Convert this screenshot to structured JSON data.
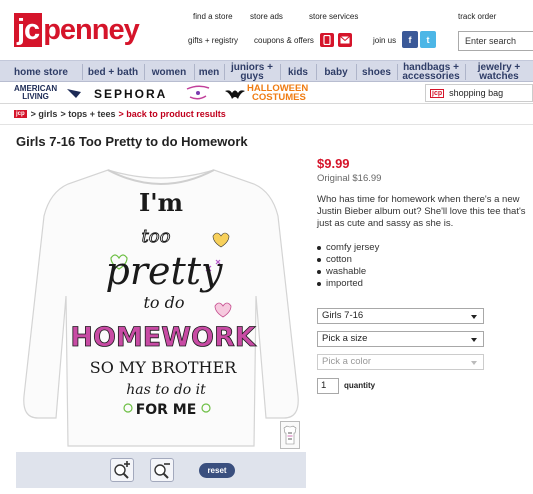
{
  "brand": {
    "logo_box": "jc",
    "logo_rest": "penney"
  },
  "top_links": {
    "find_store": "find a store",
    "store_ads": "store ads",
    "store_services": "store services",
    "track_order": "track order"
  },
  "util": {
    "gift_registry": "gifts + registry",
    "coupons": "coupons & offers",
    "join_us": "join us",
    "search_placeholder": "Enter search"
  },
  "nav": [
    {
      "label": "home store"
    },
    {
      "label": "bed + bath"
    },
    {
      "label": "women"
    },
    {
      "label": "men"
    },
    {
      "label": "juniors +\nguys"
    },
    {
      "label": "kids"
    },
    {
      "label": "baby"
    },
    {
      "label": "shoes"
    },
    {
      "label": "handbags +\naccessories"
    },
    {
      "label": "jewelry +\nwatches"
    }
  ],
  "brands": {
    "american_living_1": "AMERICAN",
    "american_living_2": "LIVING",
    "sephora": "SEPHORA",
    "halloween_1": "HALLOWEEN",
    "halloween_2": "COSTUMES",
    "shopping_bag": "shopping bag",
    "bag_mark": "jcp"
  },
  "breadcrumb": {
    "tag": "jcp",
    "girls": "> girls",
    "tops": "> tops + tees",
    "back": "> back to product results"
  },
  "product": {
    "title": "Girls 7-16 Too Pretty to do Homework",
    "price": "$9.99",
    "original": "Original $16.99",
    "description": "Who has time for homework when there's a new Justin Bieber album out? She'll love this tee that's just as cute and sassy as she is.",
    "features": [
      "comfy jersey",
      "cotton",
      "washable",
      "imported"
    ],
    "shirt_text": [
      "I'm",
      "too",
      "pretty",
      "to do",
      "HOMEWORK",
      "SO MY BROTHER",
      "has to do it",
      "FOR ME"
    ]
  },
  "selects": {
    "size_range": "Girls 7-16",
    "size": "Pick a size",
    "color": "Pick a color"
  },
  "quantity": {
    "value": "1",
    "label": "quantity"
  },
  "zoom": {
    "reset": "reset"
  },
  "colors": {
    "brand_red": "#d5142a",
    "nav_bg": "#d6dae8",
    "nav_text": "#2f3d67"
  }
}
